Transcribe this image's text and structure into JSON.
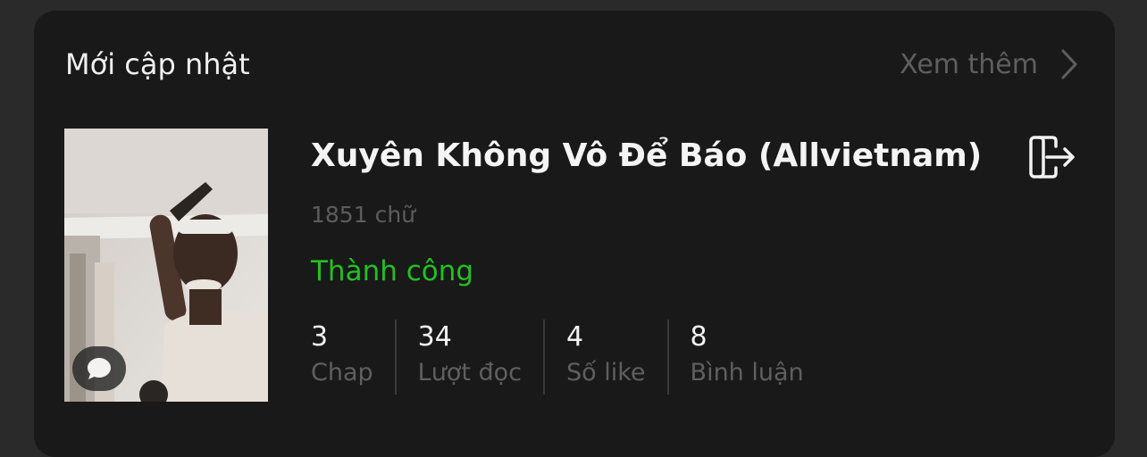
{
  "section": {
    "title": "Mới cập nhật",
    "see_more_label": "Xem thêm"
  },
  "story": {
    "title": "Xuyên Không Vô Để Báo (Allvietnam)",
    "word_count": "1851 chữ",
    "status": "Thành công",
    "status_color": "#22c11f",
    "stats": [
      {
        "value": "3",
        "label": "Chap"
      },
      {
        "value": "34",
        "label": "Lượt đọc"
      },
      {
        "value": "4",
        "label": "Số like"
      },
      {
        "value": "8",
        "label": "Bình luận"
      }
    ]
  },
  "icons": {
    "see_more": "chevron-right-icon",
    "export": "export-door-icon",
    "comment": "speech-bubble-icon"
  }
}
